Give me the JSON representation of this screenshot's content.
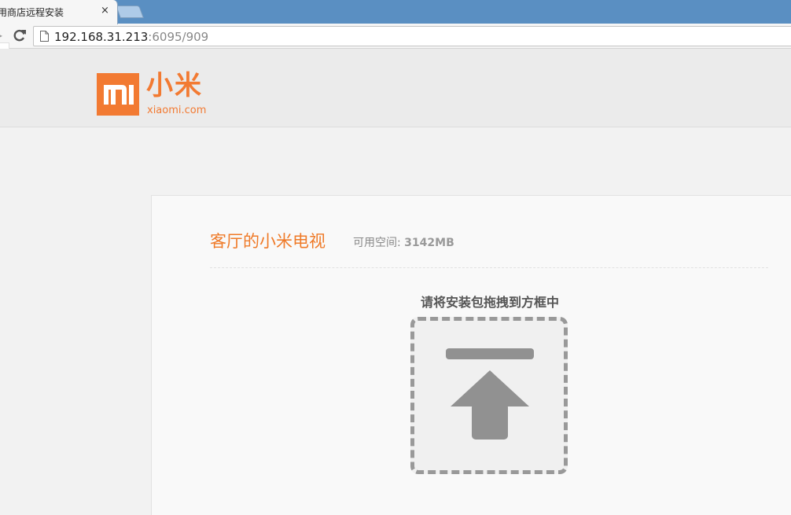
{
  "browser": {
    "tab_title": "用商店远程安装",
    "tab_close": "×",
    "url_host": "192.168.31.213",
    "url_path": ":6095/909"
  },
  "header": {
    "logo_text_cn": "小米",
    "logo_text_en": "xiaomi.com",
    "brand_color": "#f27a32"
  },
  "device": {
    "name": "客厅的小米电视",
    "space_label": "可用空间: ",
    "space_value": "3142MB"
  },
  "upload": {
    "hint": "请将安装包拖拽到方框中",
    "icon": "upload-icon"
  }
}
